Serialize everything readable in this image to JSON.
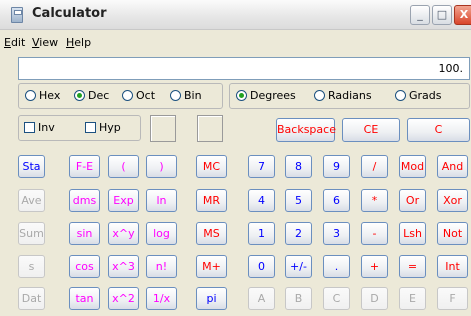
{
  "window": {
    "title": "Calculator",
    "min_label": "_",
    "max_label": "□",
    "close_label": "X"
  },
  "menu": [
    {
      "key": "E",
      "rest": "dit"
    },
    {
      "key": "V",
      "rest": "iew"
    },
    {
      "key": "H",
      "rest": "elp"
    }
  ],
  "display": {
    "value": "100."
  },
  "number_system": {
    "options": [
      "Hex",
      "Dec",
      "Oct",
      "Bin"
    ],
    "selected": "Dec"
  },
  "angle_units": {
    "options": [
      "Degrees",
      "Radians",
      "Grads"
    ],
    "selected": "Degrees"
  },
  "checkboxes": {
    "inv": "Inv",
    "hyp": "Hyp"
  },
  "edit_keys": {
    "backspace": "Backspace",
    "ce": "CE",
    "c": "C"
  },
  "statistics_keys": [
    "Sta",
    "Ave",
    "Sum",
    "s",
    "Dat"
  ],
  "sci_keys": [
    [
      "F-E",
      "(",
      ")"
    ],
    [
      "dms",
      "Exp",
      "ln"
    ],
    [
      "sin",
      "x^y",
      "log"
    ],
    [
      "cos",
      "x^3",
      "n!"
    ],
    [
      "tan",
      "x^2",
      "1/x"
    ]
  ],
  "memory_keys": [
    "MC",
    "MR",
    "MS",
    "M+",
    "pi"
  ],
  "digit_keys": [
    [
      "7",
      "8",
      "9",
      "/",
      "Mod",
      "And"
    ],
    [
      "4",
      "5",
      "6",
      "*",
      "Or",
      "Xor"
    ],
    [
      "1",
      "2",
      "3",
      "-",
      "Lsh",
      "Not"
    ],
    [
      "0",
      "+/-",
      ".",
      "+",
      "=",
      "Int"
    ],
    [
      "A",
      "B",
      "C",
      "D",
      "E",
      "F"
    ]
  ],
  "colors": {
    "blue": "#0000ff",
    "red": "#ff0000",
    "magenta": "#ff00ff",
    "disabled": "#a9a9a9",
    "selected_radio": "#21a121"
  }
}
